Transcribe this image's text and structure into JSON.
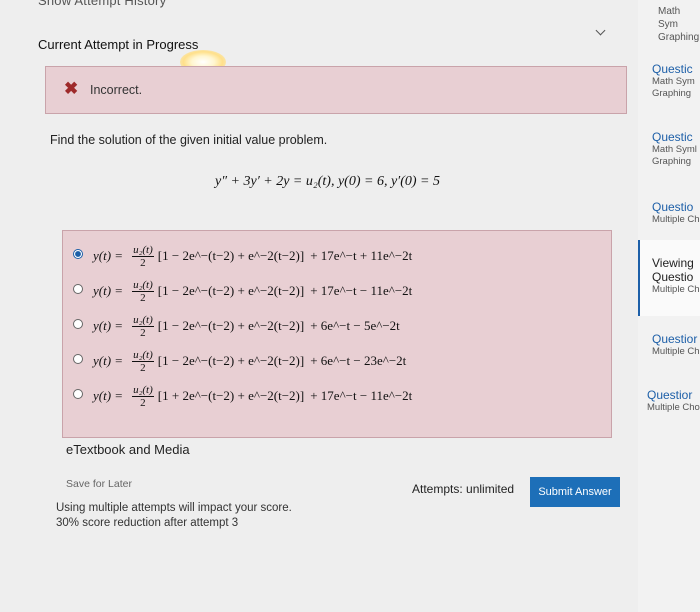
{
  "header": {
    "show_attempt_history": "Show Attempt History",
    "current_attempt": "Current Attempt in Progress"
  },
  "feedback": {
    "icon": "close-icon",
    "text": "Incorrect."
  },
  "problem": {
    "prompt": "Find the solution of the given initial value problem.",
    "equation": "y″ + 3y′ + 2y = u₂(t), y(0) = 6, y′(0) = 5"
  },
  "options": [
    {
      "lhs": "y(t) =",
      "num": "u₂(t)",
      "den": "2",
      "bracket": "[1 − 2e^−(t−2) + e^−2(t−2)]",
      "rest": "+ 17e^−t + 11e^−2t",
      "selected": true
    },
    {
      "lhs": "y(t) =",
      "num": "u₂(t)",
      "den": "2",
      "bracket": "[1 − 2e^−(t−2) + e^−2(t−2)]",
      "rest": "+ 17e^−t − 11e^−2t",
      "selected": false
    },
    {
      "lhs": "y(t) =",
      "num": "u₂(t)",
      "den": "2",
      "bracket": "[1 − 2e^−(t−2) + e^−2(t−2)]",
      "rest": "+ 6e^−t − 5e^−2t",
      "selected": false
    },
    {
      "lhs": "y(t) =",
      "num": "u₂(t)",
      "den": "2",
      "bracket": "[1 − 2e^−(t−2) + e^−2(t−2)]",
      "rest": "+ 6e^−t − 23e^−2t",
      "selected": false
    },
    {
      "lhs": "y(t) =",
      "num": "u₂(t)",
      "den": "2",
      "bracket": "[1 + 2e^−(t−2) + e^−2(t−2)]",
      "rest": "+ 17e^−t − 11e^−2t",
      "selected": false
    }
  ],
  "footer": {
    "etextbook": "eTextbook and Media",
    "save_for_later": "Save for Later",
    "attempts": "Attempts: unlimited",
    "submit": "Submit Answer",
    "note_line1": "Using multiple attempts will impact your score.",
    "note_line2": "30% score reduction after attempt 3"
  },
  "sidebar": {
    "top_line1": "Math Sym",
    "top_line2": "Graphing",
    "items": [
      {
        "title": "Questic",
        "sub1": "Math Sym",
        "sub2": "Graphing"
      },
      {
        "title": "Questic",
        "sub1": "Math Syml",
        "sub2": "Graphing"
      },
      {
        "title": "Questio",
        "sub1": "Multiple Ch",
        "sub2": ""
      },
      {
        "title": "Viewing",
        "title2": "Questio",
        "sub1": "Multiple Ch",
        "sub2": ""
      },
      {
        "title": "Questior",
        "sub1": "Multiple Ch",
        "sub2": ""
      },
      {
        "title": "Questior",
        "sub1": "Multiple Cho",
        "sub2": ""
      }
    ]
  },
  "colors": {
    "accent": "#1d6fb8",
    "incorrect_bg": "#e8cfd3",
    "incorrect_icon": "#9e2a2a"
  }
}
